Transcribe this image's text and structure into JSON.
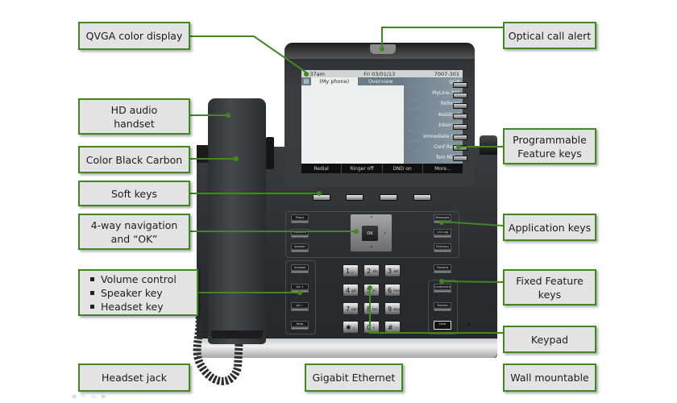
{
  "diagram": {
    "accent_color": "#3f8a1e",
    "callouts": {
      "qvga_display": "QVGA color display",
      "optical_alert": "Optical call alert",
      "hd_audio_line1": "HD audio",
      "hd_audio_line2": "handset",
      "color": "Color Black Carbon",
      "soft_keys": "Soft keys",
      "nav_line1": "4-way navigation",
      "nav_line2": "and “OK”",
      "volume_items": [
        "Volume control",
        "Speaker key",
        "Headset key"
      ],
      "headset_jack": "Headset jack",
      "gigabit": "Gigabit Ethernet",
      "programmable_line1": "Programmable",
      "programmable_line2": "Feature keys",
      "application_keys": "Application keys",
      "fixed_line1": "Fixed Feature",
      "fixed_line2": "keys",
      "keypad": "Keypad",
      "wall_mountable": "Wall mountable"
    }
  },
  "screen": {
    "time": "9:37am",
    "date": "Fri 03/01/13",
    "extension": "7007-301",
    "tabs": [
      "(My phone)",
      "Overview"
    ],
    "feature_keys": [
      "Shift",
      "MyLine-301",
      "Rollover",
      "Assistant",
      "Intercom",
      "Immediate ring",
      "Conf Room",
      "Tom Miller"
    ],
    "soft_keys": [
      "Redial",
      "Ringer off",
      "DND on",
      "More..."
    ]
  },
  "phone_keys": {
    "left_app": [
      "Phone",
      "Contacts",
      "Speaker"
    ],
    "right_app": [
      "Messages",
      "Call Log",
      "Directory"
    ],
    "audio": [
      "Headset",
      "Vol +",
      "Vol −",
      "Mute"
    ],
    "fixed": [
      "Forward",
      "Conference",
      "Transfer",
      "Hold"
    ],
    "ok": "OK",
    "dialpad": [
      {
        "digit": "1",
        "sub": "␣"
      },
      {
        "digit": "2",
        "sub": "abc"
      },
      {
        "digit": "3",
        "sub": "def"
      },
      {
        "digit": "4",
        "sub": "ghi"
      },
      {
        "digit": "5",
        "sub": "jkl"
      },
      {
        "digit": "6",
        "sub": "mno"
      },
      {
        "digit": "7",
        "sub": "pqrs"
      },
      {
        "digit": "8",
        "sub": "tuv"
      },
      {
        "digit": "9",
        "sub": "wxyz"
      },
      {
        "digit": "✱",
        "sub": "△"
      },
      {
        "digit": "0",
        "sub": "+"
      },
      {
        "digit": "#",
        "sub": "⊸"
      }
    ]
  }
}
